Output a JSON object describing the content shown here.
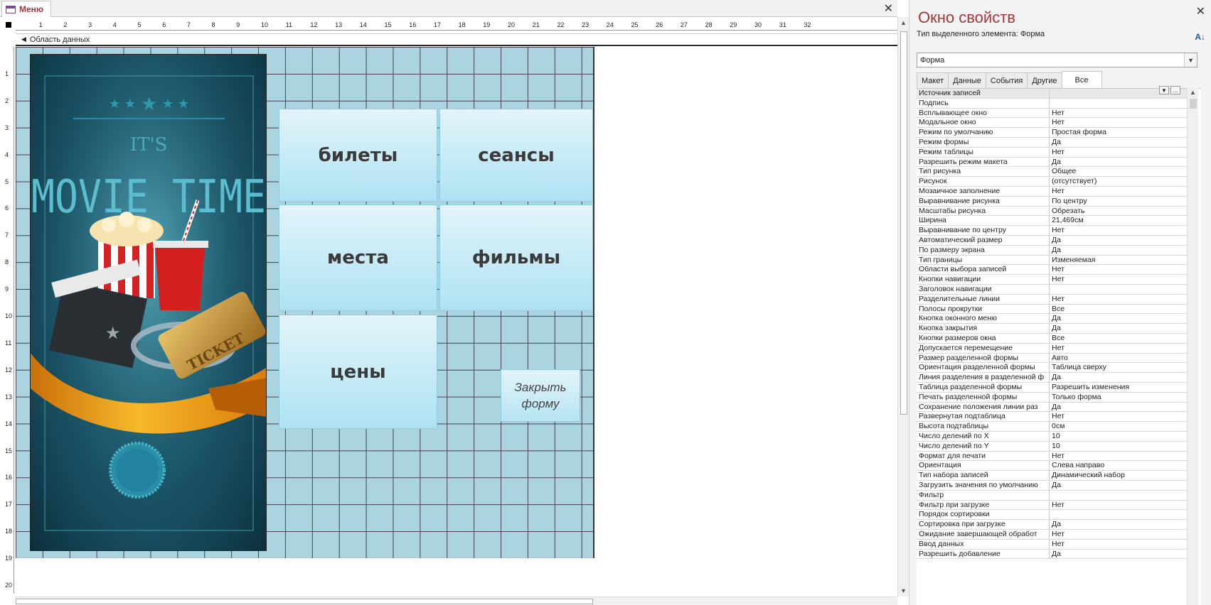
{
  "document": {
    "tab_label": "Меню",
    "section_label": "Область данных"
  },
  "ruler": {
    "top": [
      "1",
      "2",
      "3",
      "4",
      "5",
      "6",
      "7",
      "8",
      "9",
      "10",
      "11",
      "12",
      "13",
      "14",
      "15",
      "16",
      "17",
      "18",
      "19",
      "20",
      "21",
      "22",
      "23",
      "24",
      "25",
      "26",
      "27",
      "28",
      "29",
      "30",
      "31",
      "32"
    ],
    "left": [
      "1",
      "2",
      "3",
      "4",
      "5",
      "6",
      "7",
      "8",
      "9",
      "10",
      "11",
      "12",
      "13",
      "14",
      "15",
      "16",
      "17",
      "18",
      "19",
      "20"
    ]
  },
  "form": {
    "buttons": {
      "tickets": "билеты",
      "sessions": "сеансы",
      "seats": "места",
      "films": "фильмы",
      "prices": "цены",
      "close": "Закрыть форму"
    },
    "poster": {
      "line1": "IT'S",
      "line2": "MOVIE TIME",
      "ticket": "TICKET"
    }
  },
  "properties": {
    "title": "Окно свойств",
    "selection_type": "Тип выделенного элемента:  Форма",
    "object": "Форма",
    "tabs": [
      "Макет",
      "Данные",
      "События",
      "Другие",
      "Все"
    ],
    "active_tab": "Все",
    "rows": [
      {
        "name": "Источник записей",
        "value": ""
      },
      {
        "name": "Подпись",
        "value": ""
      },
      {
        "name": "Всплывающее окно",
        "value": "Нет"
      },
      {
        "name": "Модальное окно",
        "value": "Нет"
      },
      {
        "name": "Режим по умолчанию",
        "value": "Простая форма"
      },
      {
        "name": "Режим формы",
        "value": "Да"
      },
      {
        "name": "Режим таблицы",
        "value": "Нет"
      },
      {
        "name": "Разрешить режим макета",
        "value": "Да"
      },
      {
        "name": "Тип рисунка",
        "value": "Общее"
      },
      {
        "name": "Рисунок",
        "value": "(отсутствует)"
      },
      {
        "name": "Мозаичное заполнение",
        "value": "Нет"
      },
      {
        "name": "Выравнивание рисунка",
        "value": "По центру"
      },
      {
        "name": "Масштабы рисунка",
        "value": "Обрезать"
      },
      {
        "name": "Ширина",
        "value": "21,469см"
      },
      {
        "name": "Выравнивание по центру",
        "value": "Нет"
      },
      {
        "name": "Автоматический размер",
        "value": "Да"
      },
      {
        "name": "По размеру экрана",
        "value": "Да"
      },
      {
        "name": "Тип границы",
        "value": "Изменяемая"
      },
      {
        "name": "Области выбора записей",
        "value": "Нет"
      },
      {
        "name": "Кнопки навигации",
        "value": "Нет"
      },
      {
        "name": "Заголовок навигации",
        "value": ""
      },
      {
        "name": "Разделительные линии",
        "value": "Нет"
      },
      {
        "name": "Полосы прокрутки",
        "value": "Все"
      },
      {
        "name": "Кнопка оконного меню",
        "value": "Да"
      },
      {
        "name": "Кнопка закрытия",
        "value": "Да"
      },
      {
        "name": "Кнопки размеров окна",
        "value": "Все"
      },
      {
        "name": "Допускается перемещение",
        "value": "Нет"
      },
      {
        "name": "Размер разделенной формы",
        "value": "Авто"
      },
      {
        "name": "Ориентация разделенной формы",
        "value": "Таблица сверху"
      },
      {
        "name": "Линия разделения в разделенной ф",
        "value": "Да"
      },
      {
        "name": "Таблица разделенной формы",
        "value": "Разрешить изменения"
      },
      {
        "name": "Печать разделенной формы",
        "value": "Только форма"
      },
      {
        "name": "Сохранение положения линии раз",
        "value": "Да"
      },
      {
        "name": "Развернутая подтаблица",
        "value": "Нет"
      },
      {
        "name": "Высота подтаблицы",
        "value": "0см"
      },
      {
        "name": "Число делений по X",
        "value": "10"
      },
      {
        "name": "Число делений по Y",
        "value": "10"
      },
      {
        "name": "Формат для печати",
        "value": "Нет"
      },
      {
        "name": "Ориентация",
        "value": "Слева направо"
      },
      {
        "name": "Тип набора записей",
        "value": "Динамический набор"
      },
      {
        "name": "Загрузить значения по умолчанию",
        "value": "Да"
      },
      {
        "name": "Фильтр",
        "value": ""
      },
      {
        "name": "Фильтр при загрузке",
        "value": "Нет"
      },
      {
        "name": "Порядок сортировки",
        "value": ""
      },
      {
        "name": "Сортировка при загрузке",
        "value": "Да"
      },
      {
        "name": "Ожидание завершающей обработ",
        "value": "Нет"
      },
      {
        "name": "Ввод данных",
        "value": "Нет"
      },
      {
        "name": "Разрешить добавление",
        "value": "Да"
      }
    ]
  }
}
